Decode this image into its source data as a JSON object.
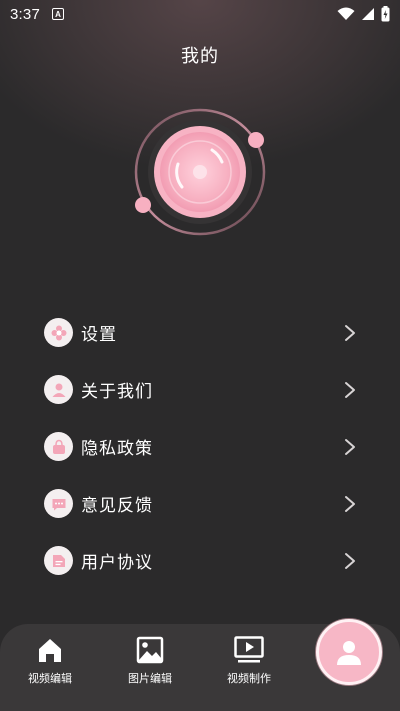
{
  "status_bar": {
    "time": "3:37",
    "notification_letter": "A"
  },
  "page_title": "我的",
  "menu": [
    {
      "label": "设置",
      "icon": "flower-icon"
    },
    {
      "label": "关于我们",
      "icon": "person-icon"
    },
    {
      "label": "隐私政策",
      "icon": "bag-icon"
    },
    {
      "label": "意见反馈",
      "icon": "chat-icon"
    },
    {
      "label": "用户协议",
      "icon": "document-icon"
    }
  ],
  "tabbar": {
    "tabs": [
      {
        "label": "视频编辑",
        "icon": "home-icon"
      },
      {
        "label": "图片编辑",
        "icon": "image-icon"
      },
      {
        "label": "视频制作",
        "icon": "video-play-icon"
      }
    ],
    "active_tab_icon": "person-icon"
  },
  "colors": {
    "accent_pink": "#f7b7c6",
    "background": "#2b2a2b",
    "tabbar": "#3a3839"
  }
}
